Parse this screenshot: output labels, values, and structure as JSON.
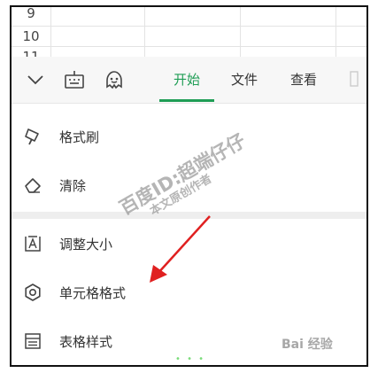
{
  "sheet": {
    "rows": [
      "9",
      "10",
      "11"
    ]
  },
  "toolbar": {
    "icons": [
      "chevron-down-icon",
      "keyboard-icon",
      "smiley-icon"
    ],
    "tabs": [
      {
        "label": "开始",
        "active": true
      },
      {
        "label": "文件",
        "active": false
      },
      {
        "label": "查看",
        "active": false
      }
    ]
  },
  "menu": {
    "items": [
      {
        "label": "格式刷",
        "icon": "format-brush-icon"
      },
      {
        "label": "清除",
        "icon": "eraser-icon"
      },
      {
        "label": "调整大小",
        "icon": "resize-icon"
      },
      {
        "label": "单元格格式",
        "icon": "gear-icon"
      },
      {
        "label": "表格样式",
        "icon": "table-style-icon"
      }
    ]
  },
  "watermark": {
    "line1": "百度ID:超端仔仔",
    "line2": "本文原创作者",
    "logo": "Bai 经验"
  },
  "colors": {
    "accent": "#1f9d55",
    "arrow": "#e02020"
  }
}
